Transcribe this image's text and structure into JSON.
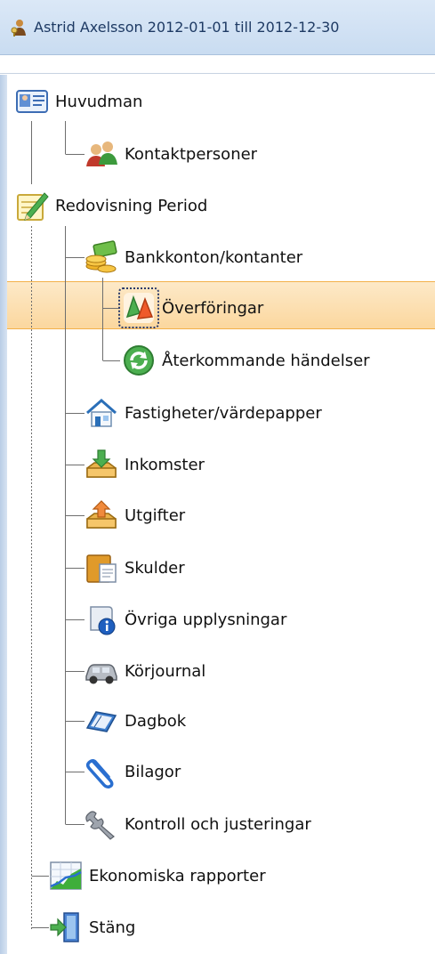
{
  "window": {
    "title": "Astrid Axelsson 2012-01-01 till 2012-12-30",
    "title_icon": "user-key-icon"
  },
  "colors": {
    "selection": "#fbd79e",
    "selection_border": "#f3b14a",
    "titlebar": "#c9dcf1",
    "tree_line": "#6e6e6e"
  },
  "tree": {
    "selected": "overforingar",
    "items": [
      {
        "id": "huvudman",
        "label": "Huvudman",
        "icon": "id-card-icon"
      },
      {
        "id": "kontaktpersoner",
        "label": "Kontaktpersoner",
        "icon": "people-icon"
      },
      {
        "id": "redovisning",
        "label": "Redovisning Period",
        "icon": "notepad-pencil-icon"
      },
      {
        "id": "bankkonton",
        "label": "Bankkonton/kontanter",
        "icon": "money-icon"
      },
      {
        "id": "overforingar",
        "label": "Överföringar",
        "icon": "transfer-icon"
      },
      {
        "id": "aterkommande",
        "label": "Återkommande händelser",
        "icon": "recurring-icon"
      },
      {
        "id": "fastigheter",
        "label": "Fastigheter/värdepapper",
        "icon": "house-icon"
      },
      {
        "id": "inkomster",
        "label": "Inkomster",
        "icon": "inbox-down-icon"
      },
      {
        "id": "utgifter",
        "label": "Utgifter",
        "icon": "outbox-up-icon"
      },
      {
        "id": "skulder",
        "label": "Skulder",
        "icon": "folder-document-icon"
      },
      {
        "id": "ovriga",
        "label": "Övriga upplysningar",
        "icon": "scroll-info-icon"
      },
      {
        "id": "korjournal",
        "label": "Körjournal",
        "icon": "car-icon"
      },
      {
        "id": "dagbok",
        "label": "Dagbok",
        "icon": "book-icon"
      },
      {
        "id": "bilagor",
        "label": "Bilagor",
        "icon": "paperclip-icon"
      },
      {
        "id": "kontroll",
        "label": "Kontroll och justeringar",
        "icon": "wrench-icon"
      },
      {
        "id": "rapporter",
        "label": "Ekonomiska rapporter",
        "icon": "chart-icon"
      },
      {
        "id": "stang",
        "label": "Stäng",
        "icon": "exit-door-icon"
      }
    ]
  }
}
